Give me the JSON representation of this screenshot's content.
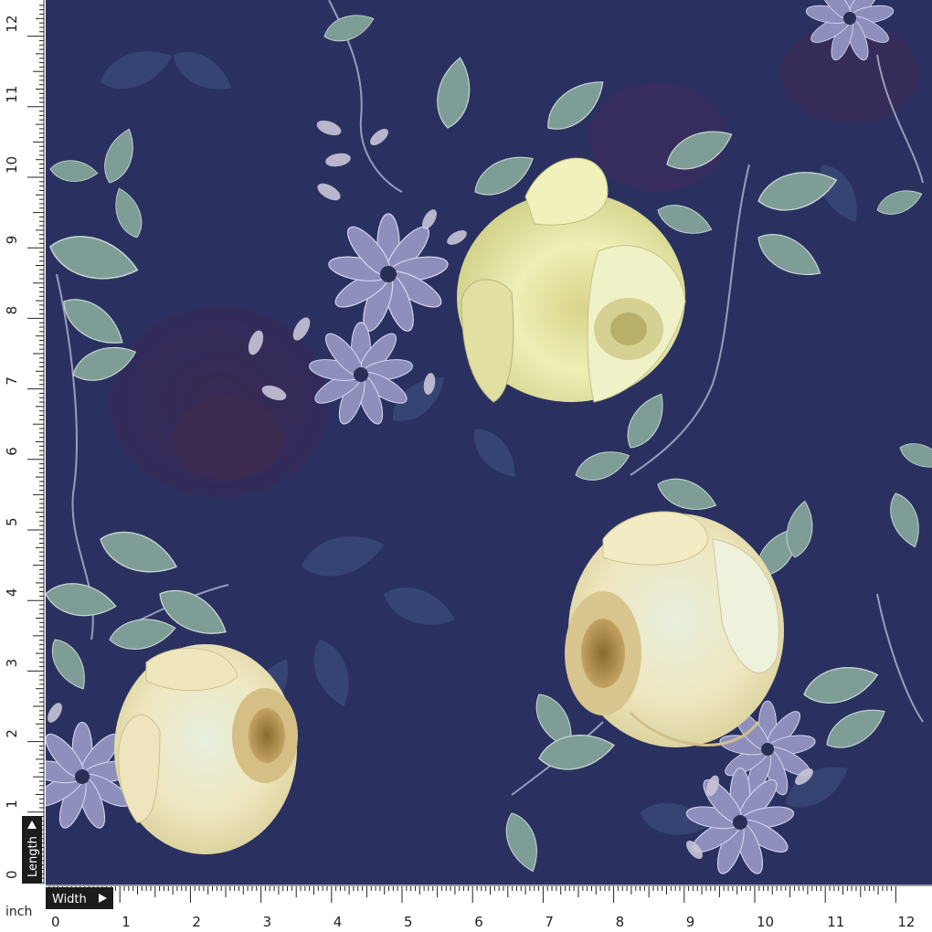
{
  "ruler": {
    "unit_label": "inch",
    "width_label": "Width",
    "length_label": "Length",
    "width_numbers": [
      "0",
      "1",
      "2",
      "3",
      "4",
      "5",
      "6",
      "7",
      "8",
      "9",
      "10",
      "11",
      "12"
    ],
    "length_numbers": [
      "0",
      "1",
      "2",
      "3",
      "4",
      "5",
      "6",
      "7",
      "8",
      "9",
      "10",
      "11",
      "12"
    ]
  },
  "colors": {
    "background_navy": "#2a3160",
    "leaf_teal": "#7f9d97",
    "rose_cream": "#efe9c6",
    "rose_yellow": "#e6e5a0",
    "rose_core": "#b08a45",
    "daisy_lavender": "#8f8fbd",
    "shadow_rose": "#3e2f5d",
    "ruler_tag": "#1c1c1c"
  },
  "icons": [
    "arrow-right-icon",
    "arrow-up-icon"
  ]
}
